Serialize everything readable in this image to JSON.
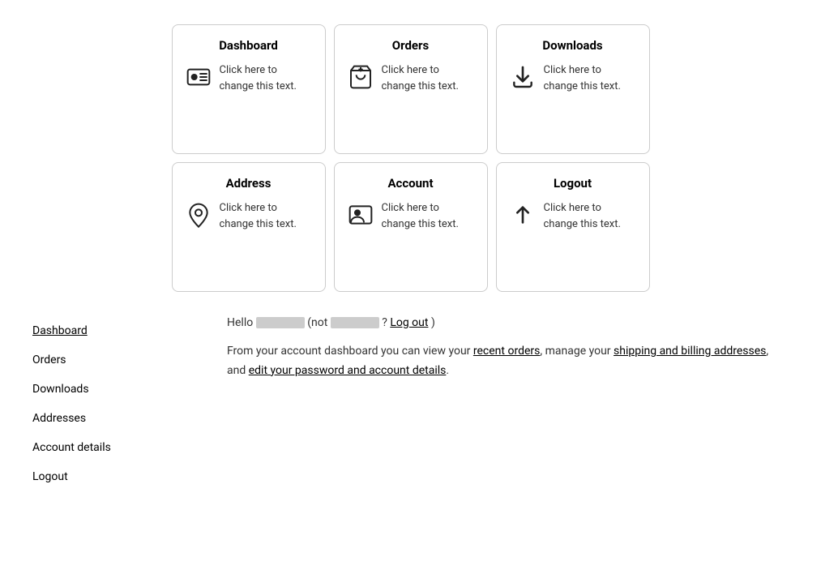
{
  "cards": [
    {
      "id": "dashboard",
      "title": "Dashboard",
      "text": "Click here to change this text.",
      "icon": "dashboard"
    },
    {
      "id": "orders",
      "title": "Orders",
      "text": "Click here to change this text.",
      "icon": "orders"
    },
    {
      "id": "downloads",
      "title": "Downloads",
      "text": "Click here to change this text.",
      "icon": "downloads"
    },
    {
      "id": "address",
      "title": "Address",
      "text": "Click here to change this text.",
      "icon": "address"
    },
    {
      "id": "account",
      "title": "Account",
      "text": "Click here to change this text.",
      "icon": "account"
    },
    {
      "id": "logout",
      "title": "Logout",
      "text": "Click here to change this text.",
      "icon": "logout"
    }
  ],
  "sidebar": {
    "items": [
      {
        "label": "Dashboard",
        "active": true
      },
      {
        "label": "Orders",
        "active": false
      },
      {
        "label": "Downloads",
        "active": false
      },
      {
        "label": "Addresses",
        "active": false
      },
      {
        "label": "Account details",
        "active": false
      },
      {
        "label": "Logout",
        "active": false
      }
    ]
  },
  "main": {
    "greeting_prefix": "Hello",
    "greeting_middle": "(not",
    "greeting_suffix": "? Log out)",
    "log_out_label": "Log out",
    "description": "From your account dashboard you can view your ",
    "link1": "recent orders",
    "desc2": ", manage your ",
    "link2": "shipping and billing addresses",
    "desc3": ", and ",
    "link3": "edit your password and account details",
    "desc4": "."
  }
}
